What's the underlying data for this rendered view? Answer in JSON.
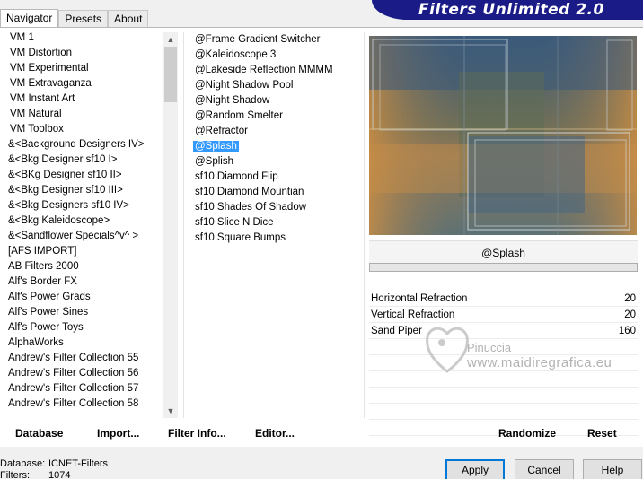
{
  "tabs": [
    "Navigator",
    "Presets",
    "About"
  ],
  "banner_title": "Filters Unlimited 2.0",
  "categories": [
    "VM 1",
    "VM Distortion",
    "VM Experimental",
    "VM Extravaganza",
    "VM Instant Art",
    "VM Natural",
    "VM Toolbox",
    "&<Background Designers IV>",
    "&<Bkg Designer sf10 I>",
    "&<BKg Designer sf10 II>",
    "&<Bkg Designer sf10 III>",
    "&<Bkg Designers sf10 IV>",
    "&<Bkg Kaleidoscope>",
    "&<Sandflower Specials^v^ >",
    "[AFS IMPORT]",
    "AB Filters 2000",
    "Alf's Border FX",
    "Alf's Power Grads",
    "Alf's Power Sines",
    "Alf's Power Toys",
    "AlphaWorks",
    "Andrew's Filter Collection 55",
    "Andrew's Filter Collection 56",
    "Andrew's Filter Collection 57",
    "Andrew's Filter Collection 58"
  ],
  "filters": [
    "@Frame Gradient Switcher",
    "@Kaleidoscope 3",
    "@Lakeside Reflection MMMM",
    "@Night Shadow Pool",
    "@Night Shadow",
    "@Random Smelter",
    "@Refractor",
    "@Splash",
    "@Splish",
    "sf10 Diamond Flip",
    "sf10 Diamond Mountian",
    "sf10 Shades Of Shadow",
    "sf10 Slice N Dice",
    "sf10 Square Bumps"
  ],
  "selected_filter_index": 7,
  "current_filter": "@Splash",
  "params": [
    {
      "label": "Horizontal Refraction",
      "value": "20"
    },
    {
      "label": "Vertical Refraction",
      "value": "20"
    },
    {
      "label": "Sand Piper",
      "value": "160"
    }
  ],
  "watermark": {
    "name": "Pinuccia",
    "url": "www.maidiregrafica.eu"
  },
  "bottom_buttons": {
    "database": "Database",
    "import": "Import...",
    "filter_info": "Filter Info...",
    "editor": "Editor...",
    "randomize": "Randomize",
    "reset": "Reset"
  },
  "status": {
    "database_label": "Database:",
    "database_value": "ICNET-Filters",
    "filters_label": "Filters:",
    "filters_value": "1074"
  },
  "dialog_buttons": {
    "apply": "Apply",
    "cancel": "Cancel",
    "help": "Help"
  },
  "colors": {
    "banner": "#1b1b88",
    "selection": "#3399ff",
    "apply_border": "#0078d7"
  }
}
